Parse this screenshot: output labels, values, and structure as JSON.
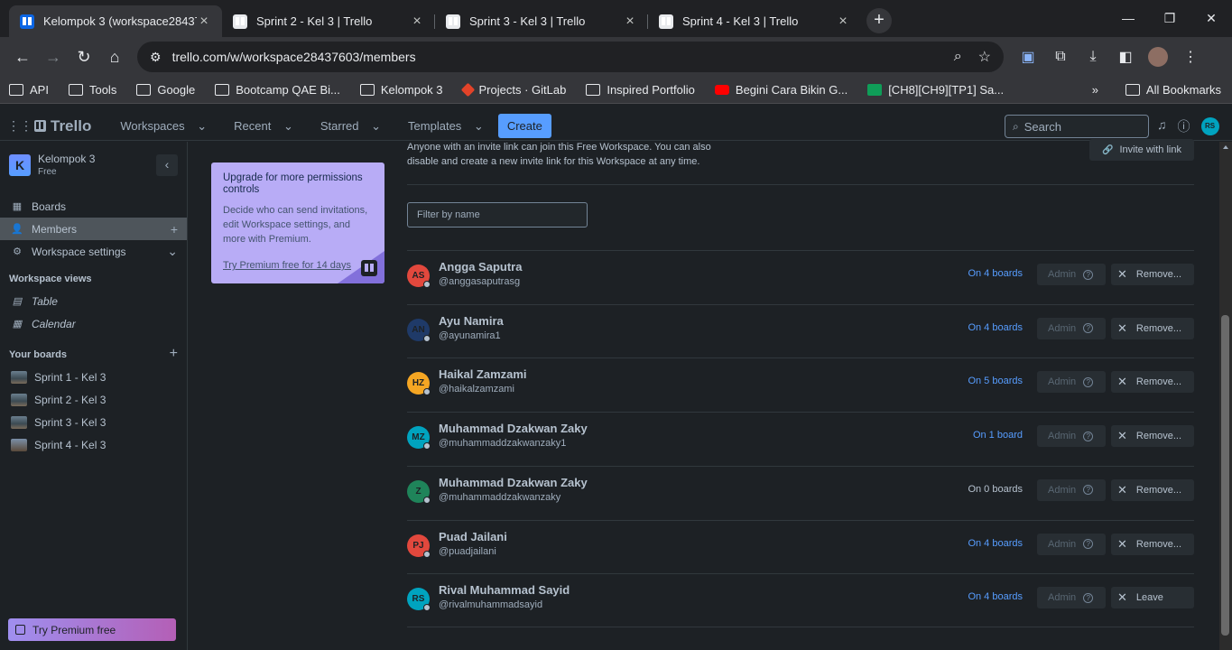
{
  "browser": {
    "tabs": [
      {
        "title": "Kelompok 3 (workspace28437603)",
        "active": true
      },
      {
        "title": "Sprint 2 - Kel 3 | Trello",
        "active": false
      },
      {
        "title": "Sprint 3 - Kel 3 | Trello",
        "active": false
      },
      {
        "title": "Sprint 4 - Kel 3 | Trello",
        "active": false
      }
    ],
    "url": "trello.com/w/workspace28437603/members",
    "bookmarks": [
      "API",
      "Tools",
      "Google",
      "Bootcamp QAE Bi...",
      "Kelompok 3",
      "Projects · GitLab",
      "Inspired Portfolio",
      "Begini Cara Bikin G...",
      "[CH8][CH9][TP1] Sa..."
    ],
    "all_bookmarks": "All Bookmarks",
    "overflow": "»"
  },
  "header": {
    "logo": "Trello",
    "nav": [
      "Workspaces",
      "Recent",
      "Starred",
      "Templates"
    ],
    "create": "Create",
    "search_placeholder": "Search",
    "avatar": "RS"
  },
  "sidebar": {
    "workspace_initial": "K",
    "workspace_name": "Kelompok 3",
    "workspace_plan": "Free",
    "nav": [
      {
        "label": "Boards",
        "icon": "board-icon"
      },
      {
        "label": "Members",
        "icon": "person-icon",
        "selected": true
      },
      {
        "label": "Workspace settings",
        "icon": "gear-icon"
      }
    ],
    "views_heading": "Workspace views",
    "views": [
      "Table",
      "Calendar"
    ],
    "boards_heading": "Your boards",
    "boards": [
      "Sprint 1 - Kel 3",
      "Sprint 2 - Kel 3",
      "Sprint 3 - Kel 3",
      "Sprint 4 - Kel 3"
    ],
    "premium": "Try Premium free"
  },
  "upgrade": {
    "title": "Upgrade for more permissions controls",
    "body": "Decide who can send invitations, edit Workspace settings, and more with Premium.",
    "link": "Try Premium free for 14 days"
  },
  "main": {
    "invite_text": "Anyone with an invite link can join this Free Workspace. You can also disable and create a new invite link for this Workspace at any time.",
    "invite_button": "Invite with link",
    "filter_placeholder": "Filter by name",
    "admin_label": "Admin",
    "members": [
      {
        "initials": "AS",
        "name": "Angga Saputra",
        "handle": "@anggasaputrasg",
        "boards": "On 4 boards",
        "action": "Remove...",
        "color": "#e2483d"
      },
      {
        "initials": "AN",
        "name": "Ayu Namira",
        "handle": "@ayunamira1",
        "boards": "On 4 boards",
        "action": "Remove...",
        "color": "#1f3a68"
      },
      {
        "initials": "HZ",
        "name": "Haikal Zamzami",
        "handle": "@haikalzamzami",
        "boards": "On 5 boards",
        "action": "Remove...",
        "color": "#f5a623"
      },
      {
        "initials": "MZ",
        "name": "Muhammad Dzakwan Zaky",
        "handle": "@muhammaddzakwanzaky1",
        "boards": "On 1 board",
        "action": "Remove...",
        "color": "#00a3bf"
      },
      {
        "initials": "Z",
        "name": "Muhammad Dzakwan Zaky",
        "handle": "@muhammaddzakwanzaky",
        "boards": "On 0 boards",
        "action": "Remove...",
        "color": "#1f845a"
      },
      {
        "initials": "PJ",
        "name": "Puad Jailani",
        "handle": "@puadjailani",
        "boards": "On 4 boards",
        "action": "Remove...",
        "color": "#e2483d"
      },
      {
        "initials": "RS",
        "name": "Rival Muhammad Sayid",
        "handle": "@rivalmuhammadsayid",
        "boards": "On 4 boards",
        "action": "Leave",
        "color": "#00a3bf"
      }
    ]
  }
}
